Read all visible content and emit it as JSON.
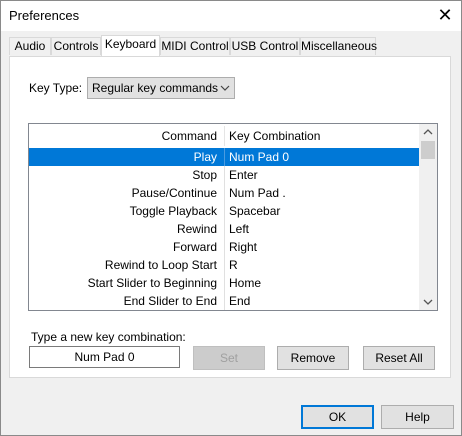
{
  "window": {
    "title": "Preferences",
    "close_glyph": "✕"
  },
  "tabs": [
    {
      "label": "Audio",
      "active": false
    },
    {
      "label": "Controls",
      "active": false
    },
    {
      "label": "Keyboard",
      "active": true
    },
    {
      "label": "MIDI Control",
      "active": false
    },
    {
      "label": "USB Control",
      "active": false
    },
    {
      "label": "Miscellaneous",
      "active": false
    }
  ],
  "keyboard": {
    "key_type_label": "Key Type:",
    "key_type_value": "Regular key commands",
    "table": {
      "columns": [
        "Command",
        "Key Combination"
      ],
      "selected_index": 0,
      "rows": [
        {
          "command": "Play",
          "key": "Num Pad 0"
        },
        {
          "command": "Stop",
          "key": "Enter"
        },
        {
          "command": "Pause/Continue",
          "key": "Num Pad ."
        },
        {
          "command": "Toggle Playback",
          "key": "Spacebar"
        },
        {
          "command": "Rewind",
          "key": "Left"
        },
        {
          "command": "Forward",
          "key": "Right"
        },
        {
          "command": "Rewind to Loop Start",
          "key": "R"
        },
        {
          "command": "Start Slider to Beginning",
          "key": "Home"
        },
        {
          "command": "End Slider to End",
          "key": "End"
        }
      ]
    },
    "new_key_label": "Type a new key combination:",
    "new_key_value": "Num Pad 0",
    "set_label": "Set",
    "remove_label": "Remove",
    "reset_all_label": "Reset All"
  },
  "footer": {
    "ok_label": "OK",
    "help_label": "Help"
  },
  "colors": {
    "selection": "#0078d7",
    "window_bg": "#f0f0f0"
  }
}
